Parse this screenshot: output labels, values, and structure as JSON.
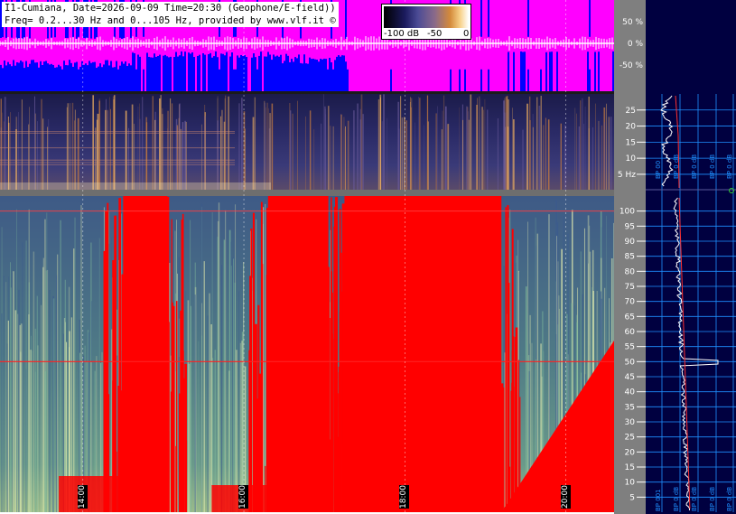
{
  "header": {
    "line1": "I1-Cumiana, Date=2026-09-09 Time=20:30 (Geophone/E-field))",
    "line2": "Freq= 0.2...30 Hz and 0...105 Hz, provided by www.vlf.it ©"
  },
  "colorbar": {
    "labels": [
      "-100 dB",
      "-50",
      "0"
    ]
  },
  "colors": {
    "waveform_bg": "#ff00ff",
    "waveform_fill": "#0000ff",
    "waveform_line": "#ffffff",
    "saturated": "#ff0000",
    "side_panel": "#000040",
    "grid": "#1e90ff",
    "axis_strip": "#7f7f7f"
  },
  "chart_data": [
    {
      "type": "area",
      "panel": "waveform",
      "y_unit": "%",
      "y_ticks": [
        "50 %",
        "0 %",
        "-50 %"
      ],
      "ylim": [
        -100,
        100
      ]
    },
    {
      "type": "heatmap",
      "panel": "spectrogram-low",
      "freq_range_hz": [
        0.2,
        30
      ],
      "y_ticks": [
        "25",
        "20",
        "15",
        "10",
        "5 Hz"
      ],
      "y_tick_values": [
        25,
        20,
        15,
        10,
        5
      ]
    },
    {
      "type": "heatmap",
      "panel": "spectrogram-high",
      "freq_range_hz": [
        0,
        105
      ],
      "y_ticks": [
        "100",
        "95",
        "90",
        "85",
        "80",
        "75",
        "70",
        "65",
        "60",
        "55",
        "50",
        "45",
        "40",
        "35",
        "30",
        "25",
        "20",
        "15",
        "10",
        "5"
      ],
      "y_tick_values": [
        100,
        95,
        90,
        85,
        80,
        75,
        70,
        65,
        60,
        55,
        50,
        45,
        40,
        35,
        30,
        25,
        20,
        15,
        10,
        5
      ],
      "time_labels": [
        "14:00",
        "16:00",
        "18:00",
        "20:00"
      ],
      "time_range_hours": [
        12.97,
        20.6
      ],
      "saturated_intervals_hours": [
        [
          14.5,
          15.05
        ],
        [
          16.3,
          17.05
        ],
        [
          17.25,
          19.2
        ]
      ],
      "line_hz": 50
    },
    {
      "type": "line",
      "panel": "spectrum-profile",
      "bp_labels_low": [
        "BP 00",
        "BP 0 dB",
        "BP 0 dB",
        "BP 0 dB",
        "BP 0 dB"
      ],
      "bp_labels_high": [
        "BP 001",
        "BP 0 dB",
        "BP 0 dB",
        "BP 0 dB",
        "BP 0 dB"
      ]
    }
  ]
}
